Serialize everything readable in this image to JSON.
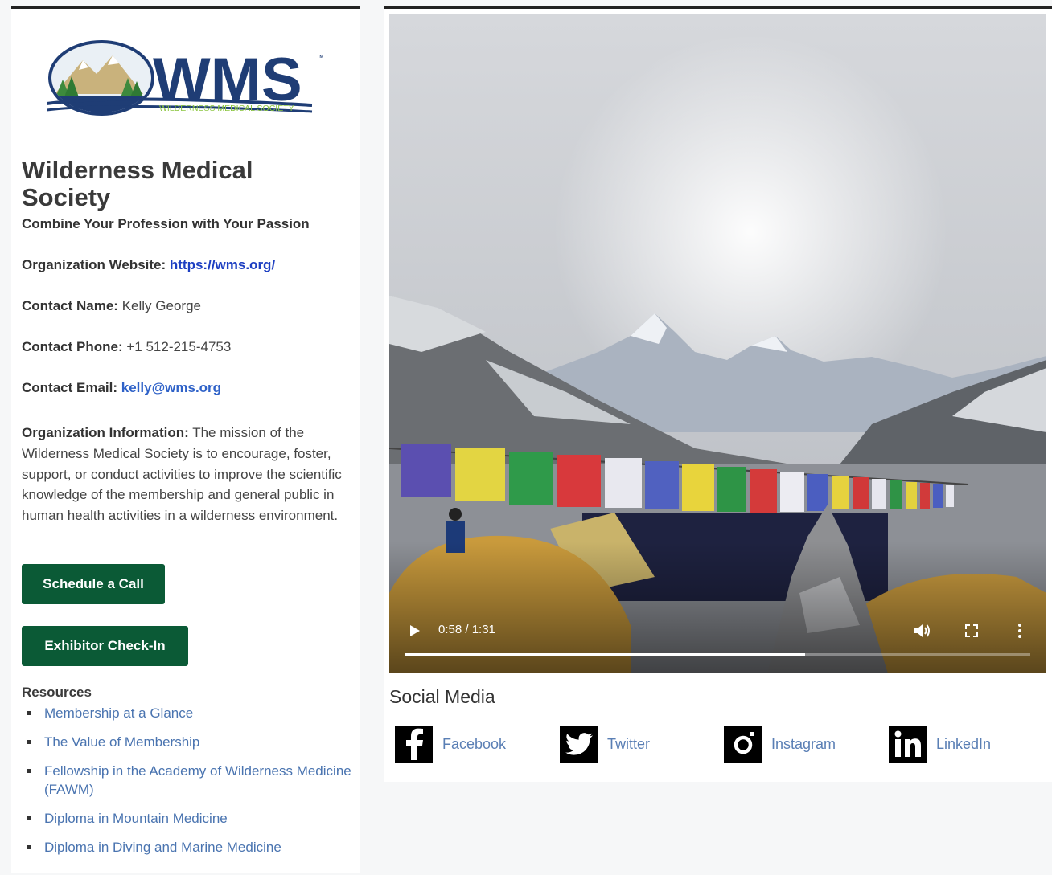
{
  "organization": {
    "logo_text": "WMS",
    "logo_subtext": "WILDERNESS MEDICAL SOCIETY",
    "logo_trademark": "™",
    "name": "Wilderness Medical Society",
    "tagline": "Combine Your Profession with Your Passion"
  },
  "details": {
    "website_label": "Organization Website:",
    "website_value": "https://wms.org/",
    "contact_name_label": "Contact Name:",
    "contact_name_value": "Kelly George",
    "contact_phone_label": "Contact Phone:",
    "contact_phone_value": "+1 512-215-4753",
    "contact_email_label": "Contact Email:",
    "contact_email_value": "kelly@wms.org",
    "info_label": "Organization Information:",
    "info_value": "The mission of the Wilderness Medical Society is to encourage, foster, support, or conduct activities to improve the scientific knowledge of the membership and general public in human health activities in a wilderness environment."
  },
  "buttons": {
    "schedule_call": "Schedule a Call",
    "exhibitor_checkin": "Exhibitor Check-In"
  },
  "resources": {
    "heading": "Resources",
    "items": [
      "Membership at a Glance",
      "The Value of Membership",
      "Fellowship in the Academy of Wilderness Medicine (FAWM)",
      "Diploma in Mountain Medicine",
      "Diploma in Diving and Marine Medicine"
    ]
  },
  "video": {
    "time": "0:58 / 1:31",
    "progress": 0.64
  },
  "social": {
    "heading": "Social Media",
    "items": [
      {
        "label": "Facebook",
        "icon": "facebook-icon"
      },
      {
        "label": "Twitter",
        "icon": "twitter-icon"
      },
      {
        "label": "Instagram",
        "icon": "instagram-icon"
      },
      {
        "label": "LinkedIn",
        "icon": "linkedin-icon"
      }
    ]
  },
  "colors": {
    "button_green": "#0b5a36",
    "link_blue": "#1d3fc2",
    "resource_link": "#4a74b0",
    "logo_navy": "#1f3d75",
    "logo_green": "#8cc63f"
  }
}
